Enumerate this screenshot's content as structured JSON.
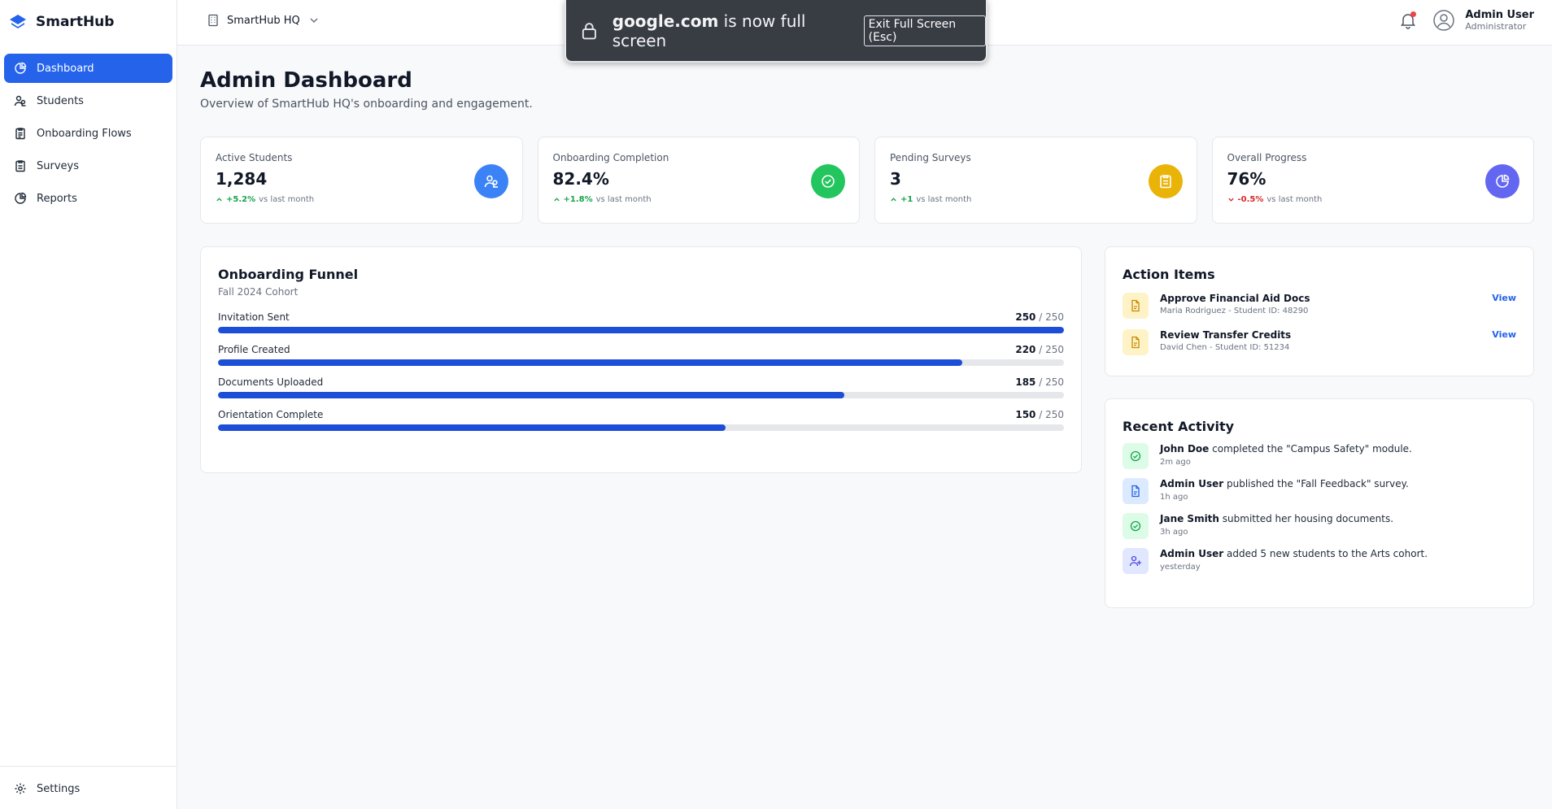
{
  "app": {
    "name": "SmartHub"
  },
  "sidebar": {
    "items": [
      {
        "label": "Dashboard",
        "icon": "chart-pie-icon",
        "active": true
      },
      {
        "label": "Students",
        "icon": "users-icon"
      },
      {
        "label": "Onboarding Flows",
        "icon": "clipboard-list-icon"
      },
      {
        "label": "Surveys",
        "icon": "clipboard-icon"
      },
      {
        "label": "Reports",
        "icon": "chart-pie-icon"
      }
    ],
    "settings_label": "Settings"
  },
  "header": {
    "org_name": "SmartHub HQ",
    "user_name": "Admin User",
    "user_role": "Administrator"
  },
  "fullscreen_toast": {
    "domain": "google.com",
    "message": " is now full screen",
    "exit_label": "Exit Full Screen (Esc)"
  },
  "page": {
    "title": "Admin Dashboard",
    "subtitle": "Overview of SmartHub HQ's onboarding and engagement."
  },
  "stats": [
    {
      "label": "Active Students",
      "value": "1,284",
      "delta": "+5.2%",
      "delta_note": "vs last month",
      "trend": "up",
      "icon": "users-icon",
      "color": "#3b82f6"
    },
    {
      "label": "Onboarding Completion",
      "value": "82.4%",
      "delta": "+1.8%",
      "delta_note": "vs last month",
      "trend": "up",
      "icon": "check-circle-icon",
      "color": "#22c55e"
    },
    {
      "label": "Pending Surveys",
      "value": "3",
      "delta": "+1",
      "delta_note": "vs last month",
      "trend": "up",
      "icon": "clipboard-icon",
      "color": "#eab308"
    },
    {
      "label": "Overall Progress",
      "value": "76%",
      "delta": "-0.5%",
      "delta_note": "vs last month",
      "trend": "down",
      "icon": "chart-pie-icon",
      "color": "#6366f1"
    }
  ],
  "funnel": {
    "title": "Onboarding Funnel",
    "subtitle": "Fall 2024 Cohort",
    "rows": [
      {
        "label": "Invitation Sent",
        "count": "250",
        "total": "/ 250",
        "fraction": 1.0
      },
      {
        "label": "Profile Created",
        "count": "220",
        "total": "/ 250",
        "fraction": 0.88
      },
      {
        "label": "Documents Uploaded",
        "count": "185",
        "total": "/ 250",
        "fraction": 0.74
      },
      {
        "label": "Orientation Complete",
        "count": "150",
        "total": "/ 250",
        "fraction": 0.6
      }
    ]
  },
  "actions": {
    "title": "Action Items",
    "items": [
      {
        "title": "Approve Financial Aid Docs",
        "meta": "Maria Rodriguez - Student ID: 48290",
        "link": "View",
        "icon": "document-icon"
      },
      {
        "title": "Review Transfer Credits",
        "meta": "David Chen - Student ID: 51234",
        "link": "View",
        "icon": "document-icon"
      }
    ]
  },
  "activity": {
    "title": "Recent Activity",
    "items": [
      {
        "actor": "John Doe",
        "text": " completed the \"Campus Safety\" module.",
        "time": "2m ago",
        "icon": "check-circle-icon",
        "bg": "#dcfce7",
        "fg": "#16a34a"
      },
      {
        "actor": "Admin User",
        "text": " published the \"Fall Feedback\" survey.",
        "time": "1h ago",
        "icon": "document-icon",
        "bg": "#dbeafe",
        "fg": "#2563eb"
      },
      {
        "actor": "Jane Smith",
        "text": " submitted her housing documents.",
        "time": "3h ago",
        "icon": "check-circle-icon",
        "bg": "#dcfce7",
        "fg": "#16a34a"
      },
      {
        "actor": "Admin User",
        "text": " added 5 new students to the Arts cohort.",
        "time": "yesterday",
        "icon": "user-plus-icon",
        "bg": "#e0e7ff",
        "fg": "#4f46e5"
      }
    ]
  }
}
